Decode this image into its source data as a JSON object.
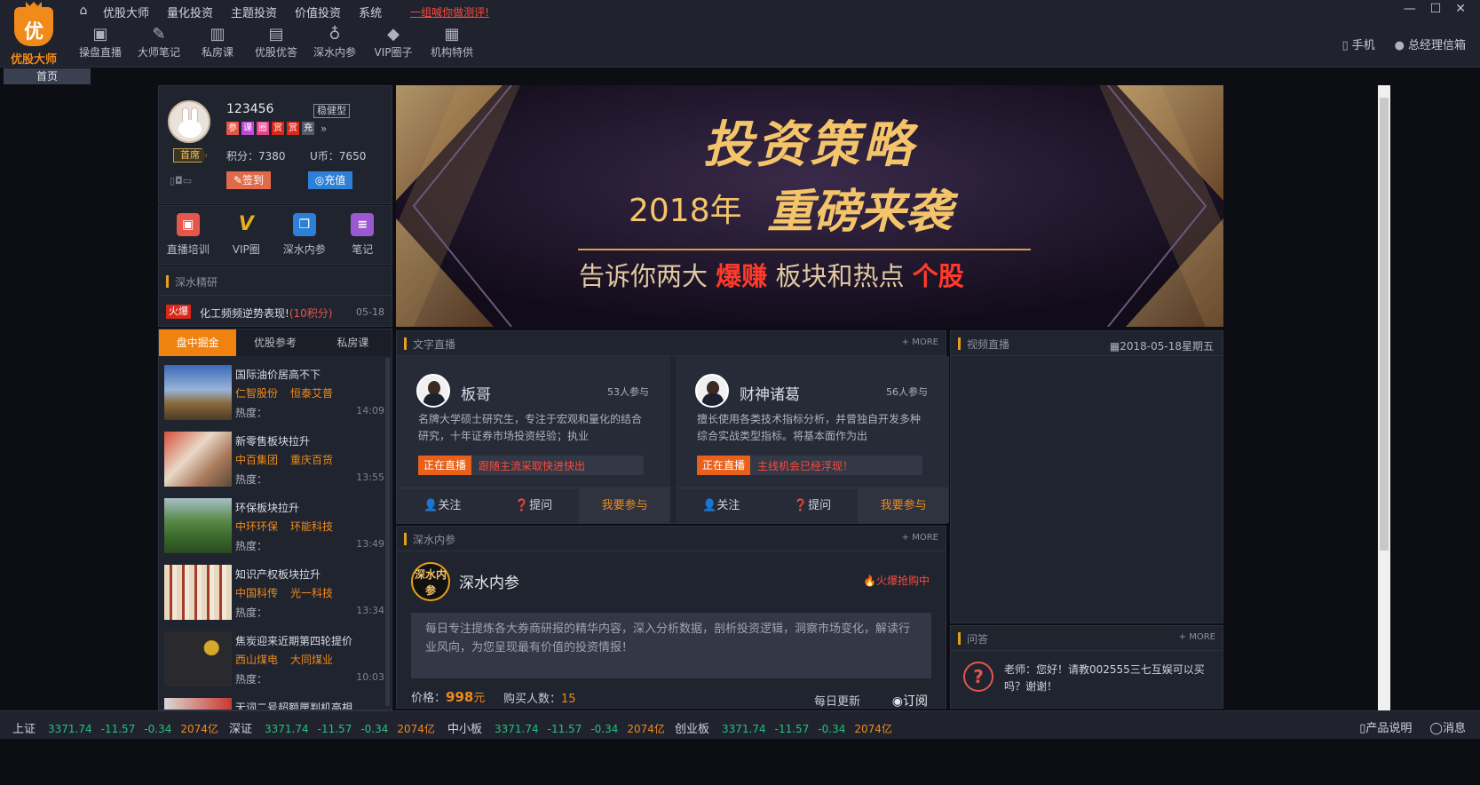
{
  "brand": {
    "logo_char": "优",
    "name": "优股大师"
  },
  "menu": {
    "items": [
      "优股大师",
      "量化投资",
      "主题投资",
      "价值投资",
      "系统"
    ],
    "promo": "一组喊你做测评!"
  },
  "toolbar": [
    {
      "label": "操盘直播",
      "icon": "live-play-icon"
    },
    {
      "label": "大师笔记",
      "icon": "pen-note-icon"
    },
    {
      "label": "私房课",
      "icon": "book-icon"
    },
    {
      "label": "优股优答",
      "icon": "chat-icon"
    },
    {
      "label": "深水内参",
      "icon": "bag-icon"
    },
    {
      "label": "VIP圈子",
      "icon": "diamond-icon"
    },
    {
      "label": "机构特供",
      "icon": "briefcase-icon"
    }
  ],
  "header_right": {
    "phone": "手机",
    "user": "总经理信箱"
  },
  "tabs": {
    "home": "首页"
  },
  "profile": {
    "username": "123456",
    "risk_type": "稳健型",
    "rank": "首席",
    "badges": [
      {
        "char": "参",
        "color": "#e6564a"
      },
      {
        "char": "课",
        "color": "#c04ad8"
      },
      {
        "char": "圈",
        "color": "#e8408a"
      },
      {
        "char": "赏",
        "color": "#d8281a"
      },
      {
        "char": "赏",
        "color": "#d8281a"
      },
      {
        "char": "充",
        "color": "#555a66"
      }
    ],
    "more": "»",
    "score_label": "积分：",
    "score": "7380",
    "coins_label": "U币：",
    "coins": "7650",
    "sign_label": "签到",
    "recharge_label": "充值"
  },
  "quicknav": [
    {
      "label": "直播培训",
      "icon": "live-training-icon",
      "color": "#e6564a",
      "glyph": "▣"
    },
    {
      "label": "VIP圈",
      "icon": "vip-icon",
      "color": "#c8901a",
      "glyph": "V"
    },
    {
      "label": "深水内参",
      "icon": "open-book-icon",
      "color": "#2d7fd8",
      "glyph": "❐"
    },
    {
      "label": "笔记",
      "icon": "notes-icon",
      "color": "#9b59d0",
      "glyph": "≡"
    }
  ],
  "deep_research": {
    "title": "深水精研",
    "item": {
      "tag": "火爆",
      "text": "化工频频逆势表现!",
      "points": "(10积分)",
      "date": "05-18"
    }
  },
  "news": {
    "tabs": [
      "盘中掘金",
      "优股参考",
      "私房课"
    ],
    "heat_label": "热度：",
    "items": [
      {
        "title": "国际油价居高不下",
        "stocks": [
          "仁智股份",
          "恒泰艾普"
        ],
        "time": "14:09",
        "thumb": "oil-pump-photo"
      },
      {
        "title": "新零售板块拉升",
        "stocks": [
          "中百集团",
          "重庆百货"
        ],
        "time": "13:55",
        "thumb": "retail-photo"
      },
      {
        "title": "环保板块拉升",
        "stocks": [
          "中环环保",
          "环能科技"
        ],
        "time": "13:49",
        "thumb": "landscape-photo"
      },
      {
        "title": "知识产权板块拉升",
        "stocks": [
          "中国科传",
          "光一科技"
        ],
        "time": "13:34",
        "thumb": "books-photo"
      },
      {
        "title": "焦炭迎来近期第四轮提价",
        "stocks": [
          "西山煤电",
          "大同煤业"
        ],
        "time": "10:03",
        "thumb": "coal-photo"
      },
      {
        "title": "无词二号超额厘判机高相",
        "stocks": [],
        "time": "",
        "thumb": "partial-photo"
      }
    ]
  },
  "banner": {
    "title": "投资策略",
    "year": "2018年",
    "subtitle": "重磅来袭",
    "tag_parts": [
      "告诉你两大",
      "爆赚",
      "板块和热点",
      "个股"
    ]
  },
  "text_live": {
    "title": "文字直播",
    "more": "+ MORE",
    "status_tag": "正在直播",
    "btn_follow": "关注",
    "btn_ask": "提问",
    "btn_join": "我要参与",
    "cards": [
      {
        "name": "板哥",
        "count": "53人参与",
        "desc": "名牌大学硕士研究生，专注于宏观和量化的结合研究，十年证券市场投资经验；执业",
        "msg": "跟随主流采取快进快出"
      },
      {
        "name": "财神诸葛",
        "count": "56人参与",
        "desc": "擅长使用各类技术指标分析，并曾独自开发多种综合实战类型指标。将基本面作为出",
        "msg": "主线机会已经浮现！"
      }
    ]
  },
  "report": {
    "title": "深水内参",
    "more": "+ MORE",
    "logo_text": "深水内参",
    "name": "深水内参",
    "hot": "火爆抢购中",
    "desc": "每日专注提炼各大券商研报的精华内容，深入分析数据，剖析投资逻辑，洞察市场变化，解读行业风向，为您呈现最有价值的投资情报！",
    "price_label": "价格：",
    "price": "998",
    "price_unit": "元",
    "buyers_label": "购买人数：",
    "buyers": "15",
    "update": "每日更新",
    "subscribe": "订阅"
  },
  "video": {
    "title": "视频直播",
    "date": "2018-05-18",
    "weekday": "星期五"
  },
  "qa": {
    "title": "问答",
    "more": "+ MORE",
    "text": "老师：您好！请教002555三七互娱可以买吗？谢谢！"
  },
  "ticker": [
    {
      "name": "上证",
      "price": "3371.74",
      "change": "-11.57",
      "pct": "-0.34",
      "amount": "2074亿"
    },
    {
      "name": "深证",
      "price": "3371.74",
      "change": "-11.57",
      "pct": "-0.34",
      "amount": "2074亿"
    },
    {
      "name": "中小板",
      "price": "3371.74",
      "change": "-11.57",
      "pct": "-0.34",
      "amount": "2074亿"
    },
    {
      "name": "创业板",
      "price": "3371.74",
      "change": "-11.57",
      "pct": "-0.34",
      "amount": "2074亿"
    }
  ],
  "footer": {
    "product": "产品说明",
    "message": "消息"
  }
}
